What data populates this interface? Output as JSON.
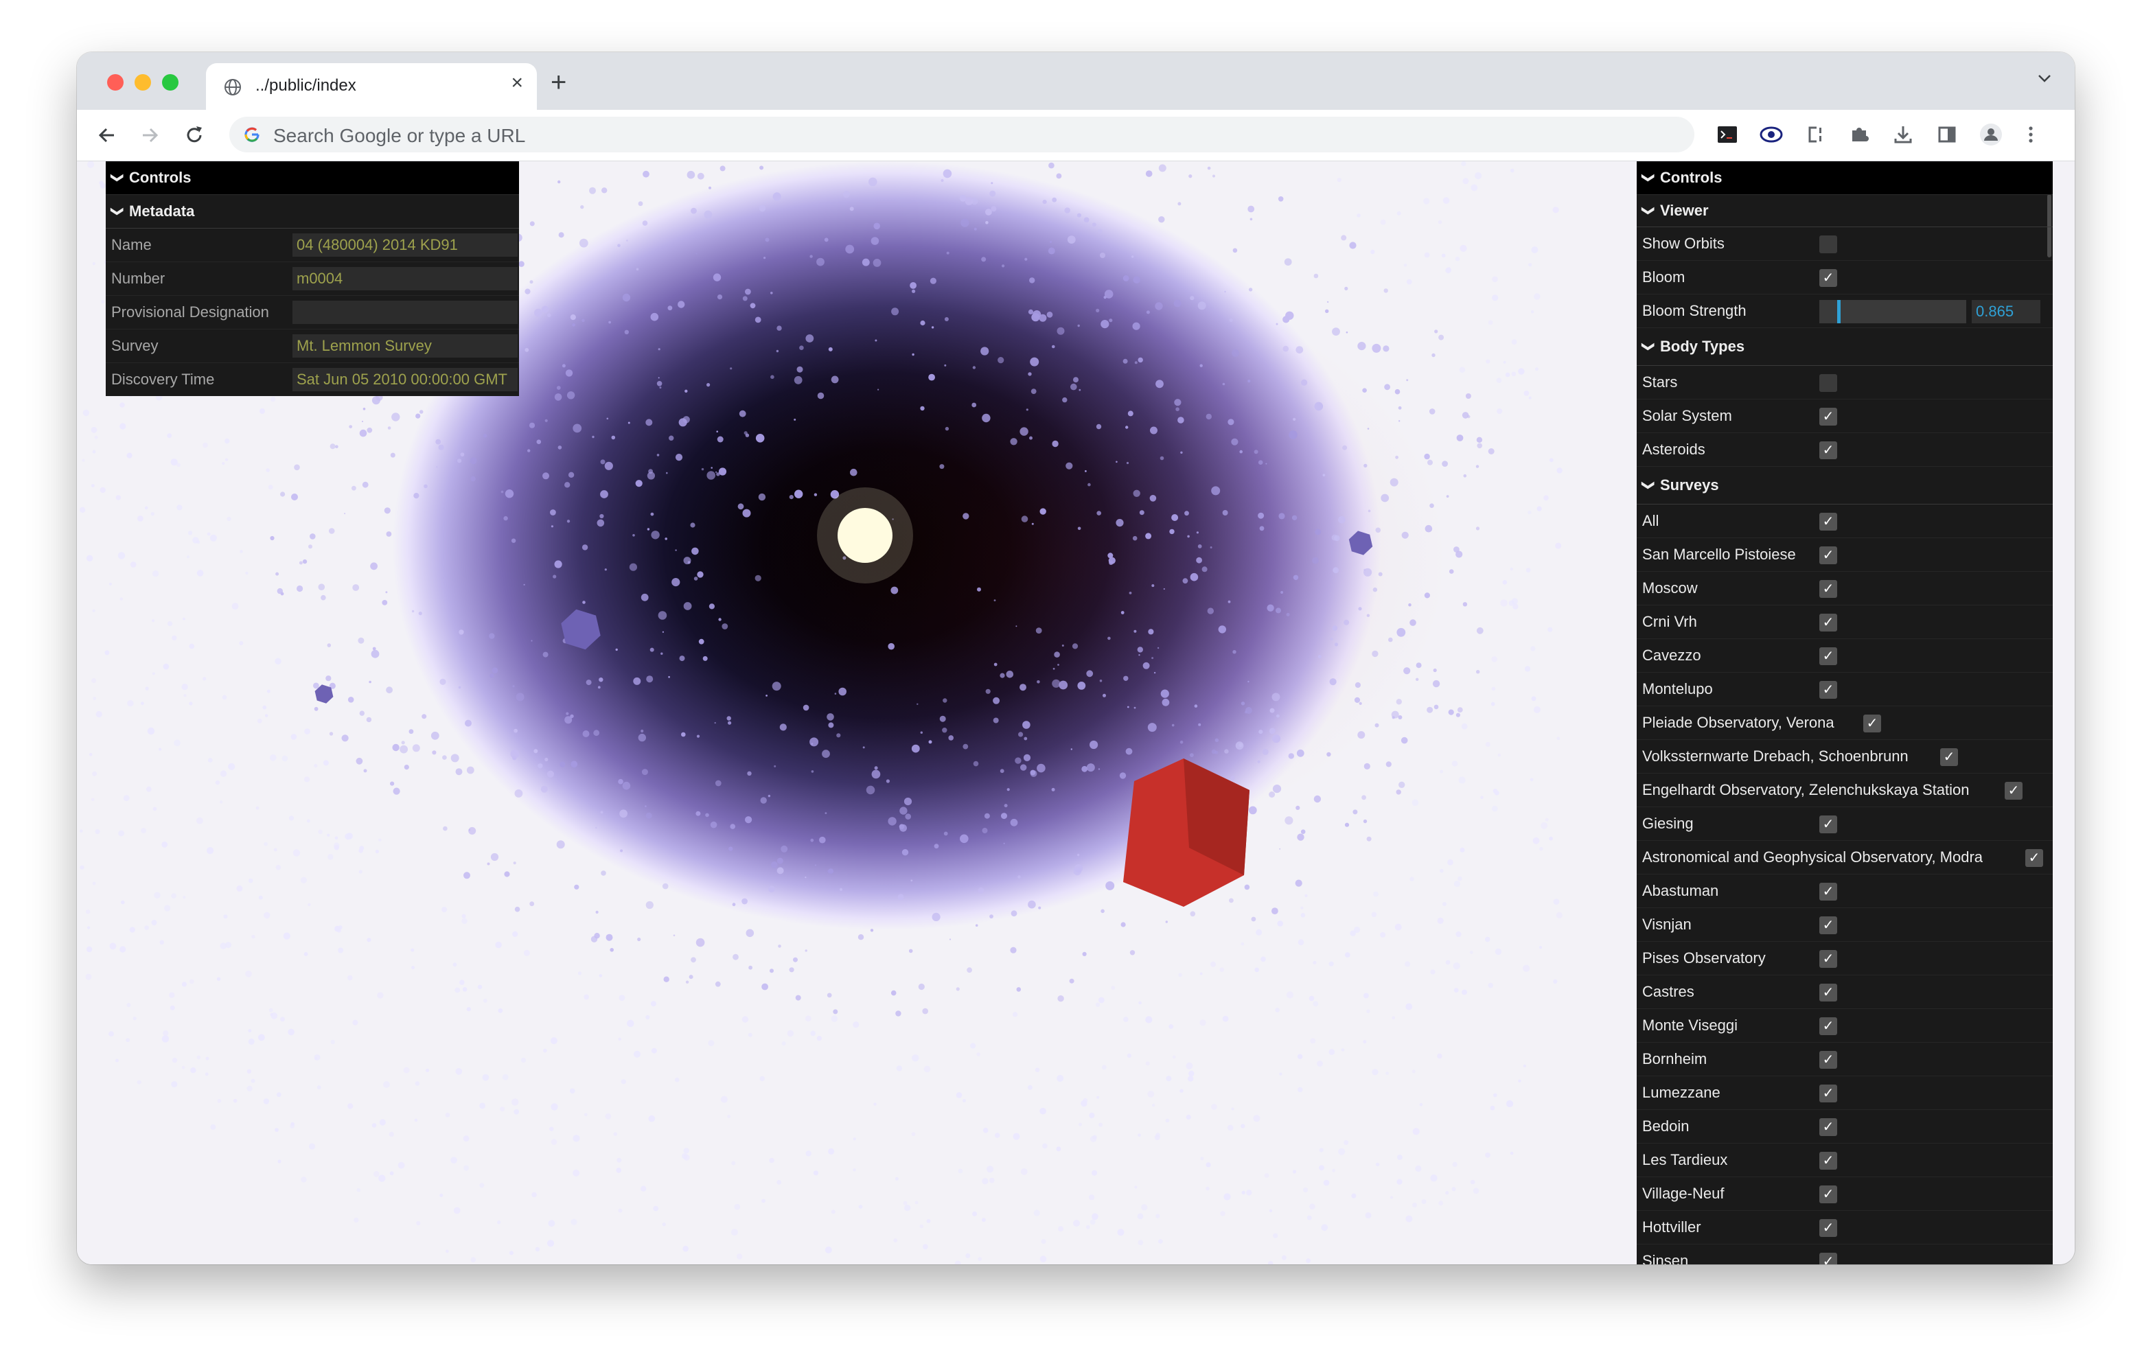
{
  "browser": {
    "tab_title": "../public/index",
    "new_tab_label": "+",
    "close_tab_label": "×",
    "omnibox_placeholder": "Search Google or type a URL"
  },
  "left_gui": {
    "title": "Controls",
    "metadata": {
      "title": "Metadata",
      "fields": [
        {
          "label": "Name",
          "value": "04 (480004) 2014 KD91"
        },
        {
          "label": "Number",
          "value": "m0004"
        },
        {
          "label": "Provisional Designation",
          "value": ""
        },
        {
          "label": "Survey",
          "value": "Mt. Lemmon Survey"
        },
        {
          "label": "Discovery Time",
          "value": "Sat Jun 05 2010 00:00:00 GMT"
        }
      ]
    }
  },
  "right_gui": {
    "title": "Controls",
    "viewer": {
      "title": "Viewer",
      "show_orbits": {
        "label": "Show Orbits",
        "checked": false
      },
      "bloom": {
        "label": "Bloom",
        "checked": true
      },
      "bloom_strength": {
        "label": "Bloom Strength",
        "value": "0.865",
        "level": 0.12
      }
    },
    "body_types": {
      "title": "Body Types",
      "items": [
        {
          "label": "Stars",
          "checked": false
        },
        {
          "label": "Solar System",
          "checked": true
        },
        {
          "label": "Asteroids",
          "checked": true
        }
      ]
    },
    "surveys": {
      "title": "Surveys",
      "items": [
        {
          "label": "All",
          "checked": true
        },
        {
          "label": "San Marcello Pistoiese",
          "checked": true
        },
        {
          "label": "Moscow",
          "checked": true
        },
        {
          "label": "Crni Vrh",
          "checked": true
        },
        {
          "label": "Cavezzo",
          "checked": true
        },
        {
          "label": "Montelupo",
          "checked": true
        },
        {
          "label": "Pleiade Observatory, Verona",
          "checked": true
        },
        {
          "label": "Volkssternwarte Drebach, Schoenbrunn",
          "checked": true
        },
        {
          "label": "Engelhardt Observatory, Zelenchukskaya Station",
          "checked": true
        },
        {
          "label": "Giesing",
          "checked": true
        },
        {
          "label": "Astronomical and Geophysical Observatory, Modra",
          "checked": true
        },
        {
          "label": "Abastuman",
          "checked": true
        },
        {
          "label": "Visnjan",
          "checked": true
        },
        {
          "label": "Pises Observatory",
          "checked": true
        },
        {
          "label": "Castres",
          "checked": true
        },
        {
          "label": "Monte Viseggi",
          "checked": true
        },
        {
          "label": "Bornheim",
          "checked": true
        },
        {
          "label": "Lumezzane",
          "checked": true
        },
        {
          "label": "Bedoin",
          "checked": true
        },
        {
          "label": "Les Tardieux",
          "checked": true
        },
        {
          "label": "Village-Neuf",
          "checked": true
        },
        {
          "label": "Hottviller",
          "checked": true
        },
        {
          "label": "Sinsen",
          "checked": true
        }
      ]
    }
  },
  "check_glyph": "✓",
  "chevron_glyph": "❯",
  "colors": {
    "gui_bg": "#1a1a1a",
    "gui_title_bg": "#000000",
    "field_text": "#9ea24d",
    "number_accent": "#2fa1d6",
    "asteroid": "#a599e0",
    "planet_red": "#c7302a",
    "sun": "#fffbe0"
  }
}
